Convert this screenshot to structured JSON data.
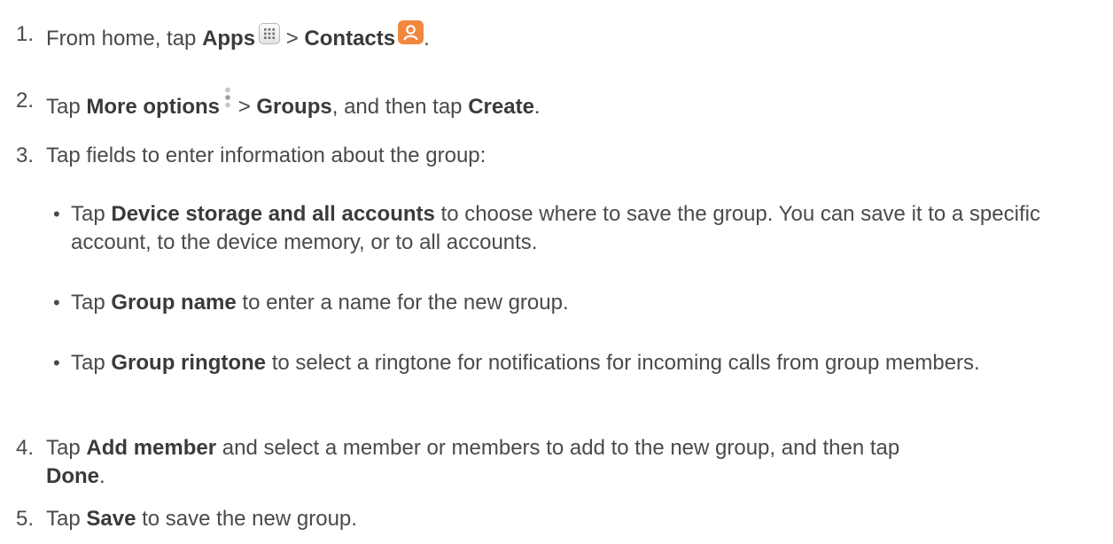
{
  "steps": [
    {
      "number": "1.",
      "text_a": "From home, tap ",
      "bold_a": "Apps",
      "sep": " > ",
      "bold_b": "Contacts",
      "text_end": "."
    },
    {
      "number": "2.",
      "text_a": "Tap ",
      "bold_a": "More options",
      "sep": " > ",
      "bold_b": "Groups",
      "text_b": ", and then tap ",
      "bold_c": "Create",
      "text_end": "."
    },
    {
      "number": "3.",
      "text": "Tap fields to enter information about the group:"
    },
    {
      "number": "4.",
      "text_a": "Tap ",
      "bold_a": "Add member",
      "text_b": " and select a member or members to add to the new group, and then tap",
      "bold_b": "Done",
      "text_end": "."
    },
    {
      "number": "5.",
      "text_a": "Tap ",
      "bold_a": "Save",
      "text_b": " to save the new group."
    }
  ],
  "bullets": [
    {
      "dot": "•",
      "text_a": "Tap ",
      "bold": "Device storage and all accounts",
      "text_b": " to choose where to save the group. You can save it to a specific account, to the device memory, or to all accounts."
    },
    {
      "dot": "•",
      "text_a": "Tap ",
      "bold": "Group name",
      "text_b": " to enter a name for the new group."
    },
    {
      "dot": "•",
      "text_a": "Tap ",
      "bold": "Group ringtone",
      "text_b": " to select a ringtone for notifications for incoming calls from group members."
    }
  ],
  "icons": {
    "apps": "apps-grid-icon",
    "contacts": "contacts-person-icon",
    "more": "more-options-vertical-dots-icon"
  },
  "colors": {
    "text": "#4a4a4a",
    "contacts_icon": "#f1883d"
  }
}
